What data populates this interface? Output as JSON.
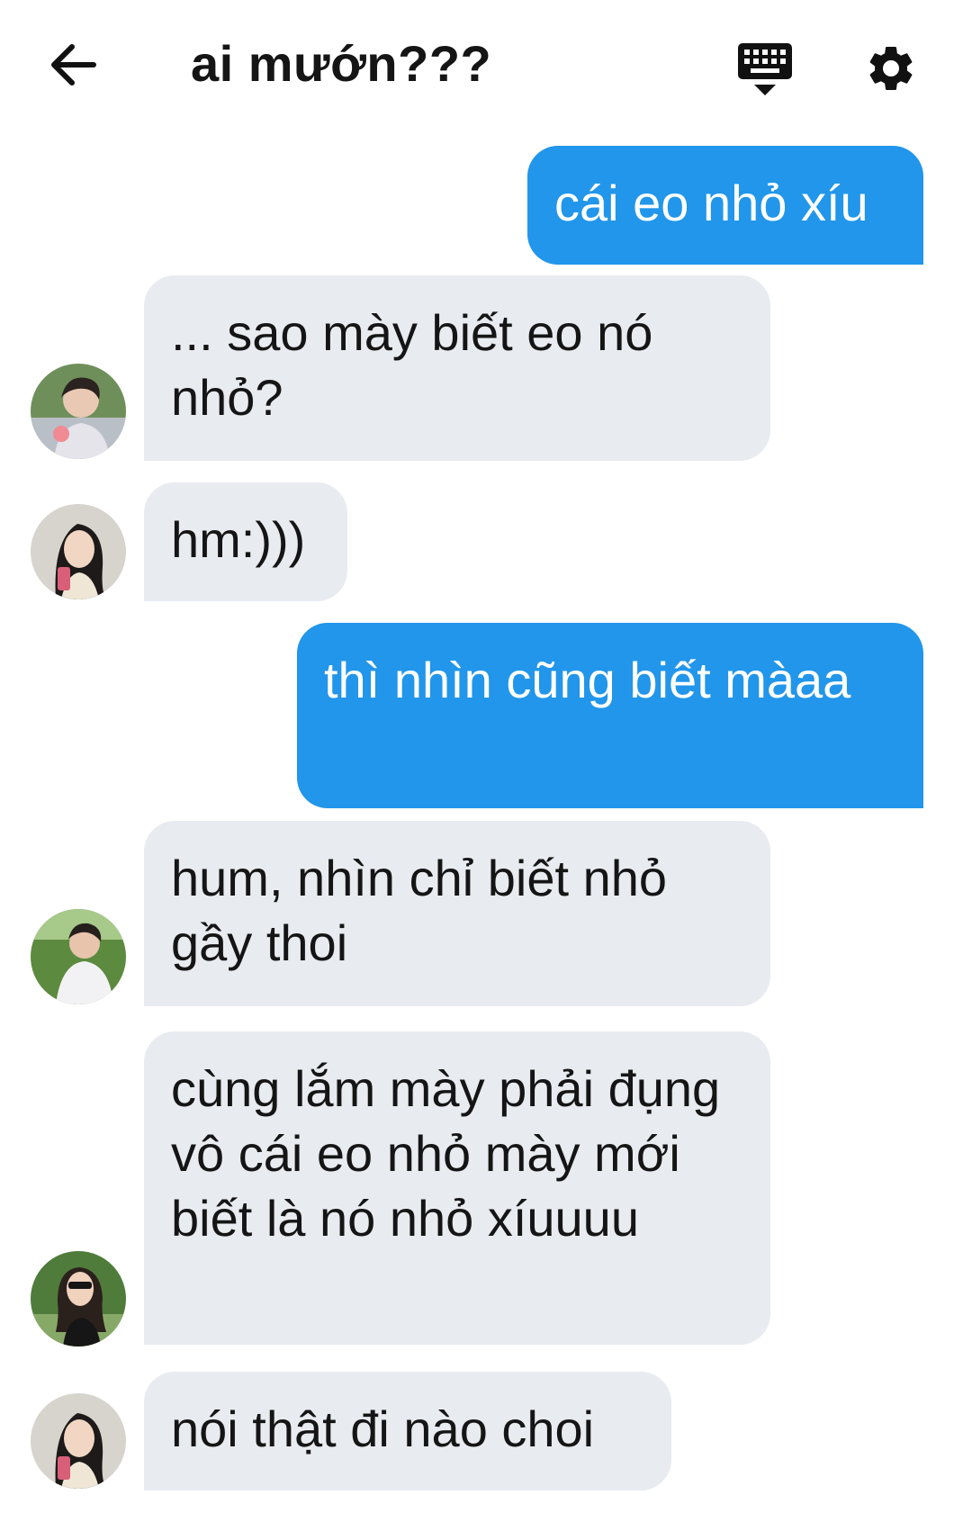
{
  "header": {
    "title": "ai mướn???",
    "back_icon": "arrow-left-icon",
    "keyboard_icon": "keyboard-icon",
    "settings_icon": "gear-icon"
  },
  "colors": {
    "outgoing_bubble": "#2196ea",
    "incoming_bubble": "#e8ebef",
    "icon": "#111111"
  },
  "messages": [
    {
      "direction": "outgoing",
      "text": "cái eo nhỏ xíu"
    },
    {
      "direction": "incoming",
      "avatar": "avatar-boy-1",
      "text": "... sao mày biết eo nó nhỏ?"
    },
    {
      "direction": "incoming",
      "avatar": "avatar-girl-1",
      "text": "hm:)))"
    },
    {
      "direction": "outgoing",
      "text": "thì nhìn cũng biết màaa"
    },
    {
      "direction": "incoming",
      "avatar": "avatar-boy-2",
      "text": "hum, nhìn chỉ biết nhỏ gầy thoi"
    },
    {
      "direction": "incoming",
      "avatar": "avatar-girl-2",
      "text": "cùng lắm mày phải đụng vô cái eo nhỏ mày mới biết là nó nhỏ xíuuuu"
    },
    {
      "direction": "incoming",
      "avatar": "avatar-girl-1",
      "text": "nói thật đi nào choi"
    }
  ]
}
